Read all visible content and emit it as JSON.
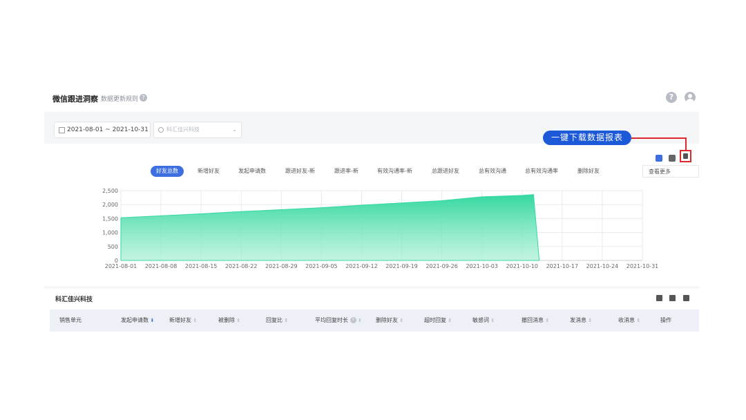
{
  "app": {
    "title": "微信跟进洞察",
    "subtitle": "数据更新规则"
  },
  "filters": {
    "date_range": "2021-08-01  ~ 2021-10-31",
    "search_placeholder": "科汇佳兴科技"
  },
  "tabs": [
    "好友总数",
    "新增好友",
    "发起申请数",
    "跟进好友-新",
    "跟进率-新",
    "有效沟通率-新",
    "总跟进好友",
    "总有效沟通",
    "总有效沟通率",
    "删除好友"
  ],
  "active_tab": "好友总数",
  "toolbar": {
    "more_label": "查看更多"
  },
  "chart_data": {
    "type": "area",
    "x_labels": [
      "2021-08-01",
      "2021-08-08",
      "2021-08-15",
      "2021-08-22",
      "2021-08-29",
      "2021-09-05",
      "2021-09-12",
      "2021-09-19",
      "2021-09-26",
      "2021-10-03",
      "2021-10-10",
      "2021-10-17",
      "2021-10-24",
      "2021-10-31"
    ],
    "y_ticks": [
      0,
      500,
      "1,000",
      "1,500",
      "2,000",
      "2,500"
    ],
    "ylim": [
      0,
      2500
    ],
    "grid": true,
    "series": [
      {
        "color": "#34d8a0",
        "x": [
          "2021-08-01",
          "2021-08-08",
          "2021-08-15",
          "2021-08-22",
          "2021-08-29",
          "2021-09-05",
          "2021-09-12",
          "2021-09-19",
          "2021-09-26",
          "2021-10-03",
          "2021-10-10",
          "2021-10-12",
          "2021-10-13"
        ],
        "values": [
          1530,
          1600,
          1670,
          1750,
          1820,
          1890,
          1980,
          2060,
          2140,
          2280,
          2330,
          2360,
          0
        ]
      }
    ]
  },
  "table": {
    "title": "科汇佳兴科技",
    "columns": [
      "销售单元",
      "发起申请数",
      "新增好友",
      "被删除",
      "回复比",
      "平均回复时长",
      "删除好友",
      "超时回复",
      "敏感词",
      "撤回消息",
      "发消息",
      "收消息",
      "操作"
    ]
  },
  "annotation": {
    "callout_text": "一键下载数据报表",
    "color": "#e0282c"
  }
}
